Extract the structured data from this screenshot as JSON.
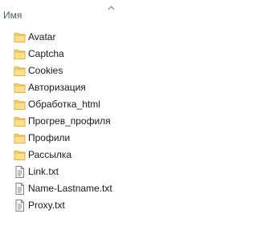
{
  "header": {
    "column_name": "Имя",
    "sort_direction": "ascending"
  },
  "items": [
    {
      "name": "Avatar",
      "type": "folder"
    },
    {
      "name": "Captcha",
      "type": "folder"
    },
    {
      "name": "Cookies",
      "type": "folder"
    },
    {
      "name": "Авторизация",
      "type": "folder"
    },
    {
      "name": "Обработка_html",
      "type": "folder"
    },
    {
      "name": "Прогрев_профиля",
      "type": "folder"
    },
    {
      "name": "Профили",
      "type": "folder"
    },
    {
      "name": "Рассылка",
      "type": "folder"
    },
    {
      "name": "Link.txt",
      "type": "text-file"
    },
    {
      "name": "Name-Lastname.txt",
      "type": "text-file"
    },
    {
      "name": "Proxy.txt",
      "type": "text-file"
    }
  ],
  "colors": {
    "header_text": "#4c607a",
    "folder_fill": "#ffd76e",
    "folder_edge": "#e0b13f"
  }
}
